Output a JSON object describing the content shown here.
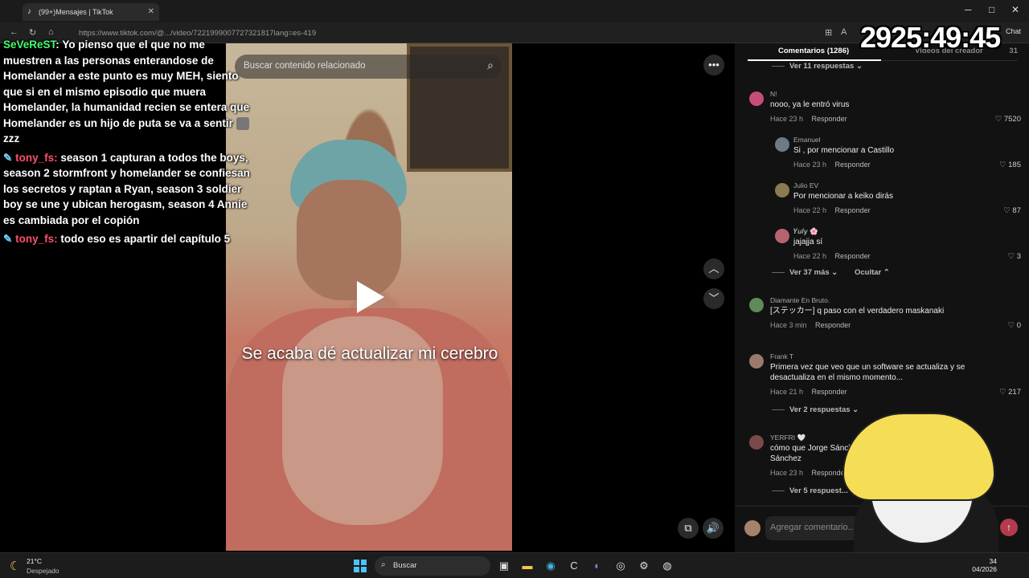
{
  "browser": {
    "tab_title": "(99+)Mensajes | TikTok",
    "url": "https://www.tiktok.com/@.../video/7221999007727321817lang=es-419",
    "chat_label": "Chat"
  },
  "video": {
    "search_placeholder": "Buscar contenido relacionado",
    "caption": "Se acaba dé actualizar mi cerebro"
  },
  "stream_chat": {
    "messages": [
      {
        "user": "SeVeReST",
        "text": "Yo pienso que el que no me muestren a las personas enterandose de Homelander a este punto es muy MEH, siento que si en el mismo episodio que muera Homelander, la humanidad recien se entera que Homelander es un hijo de puta se va a sentir",
        "suffix": "zzz"
      },
      {
        "user": "tony_fs:",
        "text": "season 1 capturan a todos the boys, season 2 stormfront y homelander se confiesan los secretos y raptan a Ryan, season 3 soldier boy se une y ubican herogasm, season 4 Annie es cambiada por el copión"
      },
      {
        "user": "tony_fs:",
        "text": "todo eso es apartir del capítulo 5"
      }
    ]
  },
  "timer": "2925:49:45",
  "comments_panel": {
    "tab_comments": "Comentarios (1286)",
    "tab_creator": "Videos del creador",
    "tab_count": "31",
    "view_11": "Ver 11 respuestas",
    "comments": [
      {
        "author": "N!",
        "text": "nooo, ya le entró virus",
        "time": "Hace 23 h",
        "reply": "Responder",
        "likes": "7520"
      },
      {
        "author": "Emanuel",
        "text": "Si , por mencionar a Castillo",
        "time": "Hace 23 h",
        "reply": "Responder",
        "likes": "185"
      },
      {
        "author": "Julio EV",
        "text": "Por mencionar a keiko dirás",
        "time": "Hace 22 h",
        "reply": "Responder",
        "likes": "87"
      },
      {
        "author": "𝒀𝒖𝒍𝒚 🌸",
        "text": "jajajja sí",
        "time": "Hace 22 h",
        "reply": "Responder",
        "likes": "3"
      },
      {
        "author": "Diamante En Bruto.",
        "text": "[ステッカー] q paso con el verdadero maskanaki",
        "time": "Hace 3 min",
        "reply": "Responder",
        "likes": "0"
      },
      {
        "author": "Frank T",
        "text": "Primera vez que veo que un software se actualiza y se desactualiza en el mismo momento...",
        "time": "Hace 21 h",
        "reply": "Responder",
        "likes": "217"
      },
      {
        "author": "YERFRI 🤍",
        "text": "cómo que Jorge Sánchez Sánchez",
        "time": "Hace 23 h",
        "reply": "Responder",
        "likes": ""
      }
    ],
    "view_37": "Ver 37 más",
    "hide": "Ocultar",
    "view_2": "Ver 2 respuestas",
    "view_5": "Ver 5 respuest...",
    "comment_placeholder": "Agregar comentario..."
  },
  "taskbar": {
    "temp": "21°C",
    "weather": "Despejado",
    "search": "Buscar",
    "clock_time": "34",
    "clock_date": "04/2026"
  }
}
